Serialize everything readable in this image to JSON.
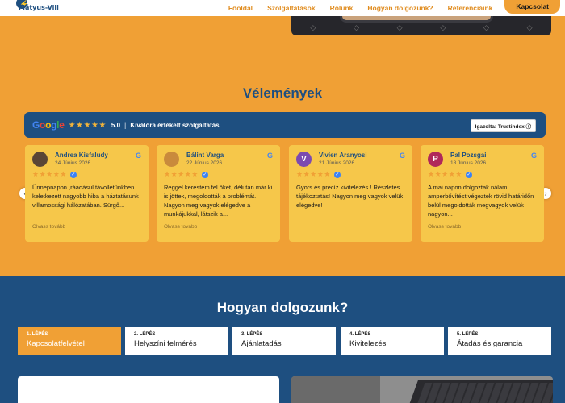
{
  "header": {
    "logo_text": "Mátyus-Vill",
    "nav": [
      "Főoldal",
      "Szolgáltatások",
      "Rólunk",
      "Hogyan dolgozunk?",
      "Referenciáink"
    ],
    "cta": "Kapcsolat"
  },
  "reviews": {
    "title": "Vélemények",
    "google_word": "Google",
    "stars": "★★★★★",
    "score": "5.0",
    "separator": "|",
    "summary": "Kiválóra értékelt szolgáltatás",
    "verified": "Igazolta: Trustindex ⓘ",
    "items": [
      {
        "name": "Andrea Kisfaludy",
        "date": "24 Június 2026",
        "stars": "★★★★★",
        "text": "Ünnepnapon ,ráadásul távollétünkben keletkezett nagyobb hiba a háztatásunk villamossági hálózatában. Sürgő...",
        "more": "Olvass tovább",
        "avatar_color": "#5a4636",
        "avatar_letter": ""
      },
      {
        "name": "Bálint Varga",
        "date": "22 Június 2026",
        "stars": "★★★★★",
        "text": "Reggel kerestem fel őket, délután már ki is jöttek, megoldották a problémát. Nagyon meg vagyok elégedve a munkájukkal, látszik a...",
        "more": "Olvass tovább",
        "avatar_color": "#c98a3c",
        "avatar_letter": ""
      },
      {
        "name": "Vivien Aranyosi",
        "date": "21 Június 2026",
        "stars": "★★★★★",
        "text": "Gyors és precíz kivitelezés ! Részletes tájékoztatás! Nagyon meg vagyok velük elégedve!",
        "more": "",
        "avatar_color": "#7c4ab0",
        "avatar_letter": "V"
      },
      {
        "name": "Pal Pozsgai",
        "date": "18 Június 2026",
        "stars": "★★★★★",
        "text": "A mai napon dolgoztak nálam amperbővítést végeztek rövid határidőn belül megoldották megvagyok velük nagyon...",
        "more": "Olvass tovább",
        "avatar_color": "#b0285a",
        "avatar_letter": "P"
      }
    ],
    "arrow_prev": "‹",
    "arrow_next": "›"
  },
  "process": {
    "title": "Hogyan dolgozunk?",
    "steps": [
      {
        "num": "1. LÉPÉS",
        "label": "Kapcsolatfelvétel"
      },
      {
        "num": "2. LÉPÉS",
        "label": "Helyszíni felmérés"
      },
      {
        "num": "3. LÉPÉS",
        "label": "Ajánlatadás"
      },
      {
        "num": "4. LÉPÉS",
        "label": "Kivitelezés"
      },
      {
        "num": "5. LÉPÉS",
        "label": "Átadás és garancia"
      }
    ],
    "active_step": 1
  },
  "colors": {
    "orange": "#f0a035",
    "navy": "#1e4f80",
    "card_yellow": "#f6c74a"
  }
}
